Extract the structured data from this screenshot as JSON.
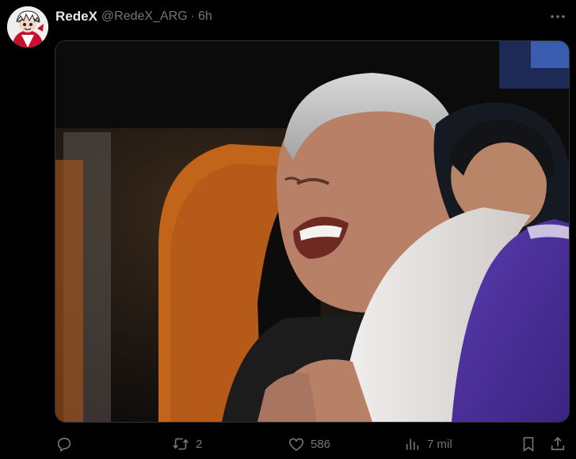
{
  "author": {
    "display_name": "RedeX",
    "handle": "@RedeX_ARG",
    "separator": "·",
    "time": "6h"
  },
  "media": {
    "description_icon": "photo"
  },
  "actions": {
    "reply": {
      "icon": "reply-icon",
      "count": ""
    },
    "retweet": {
      "icon": "retweet-icon",
      "count": "2"
    },
    "like": {
      "icon": "heart-icon",
      "count": "586"
    },
    "views": {
      "icon": "views-icon",
      "count": "7 mil"
    },
    "bookmark": {
      "icon": "bookmark-icon"
    },
    "share": {
      "icon": "share-icon"
    }
  },
  "colors": {
    "background": "#000000",
    "primary_text": "#e7e9ea",
    "secondary_text": "#71767b",
    "border": "#2f3336"
  }
}
